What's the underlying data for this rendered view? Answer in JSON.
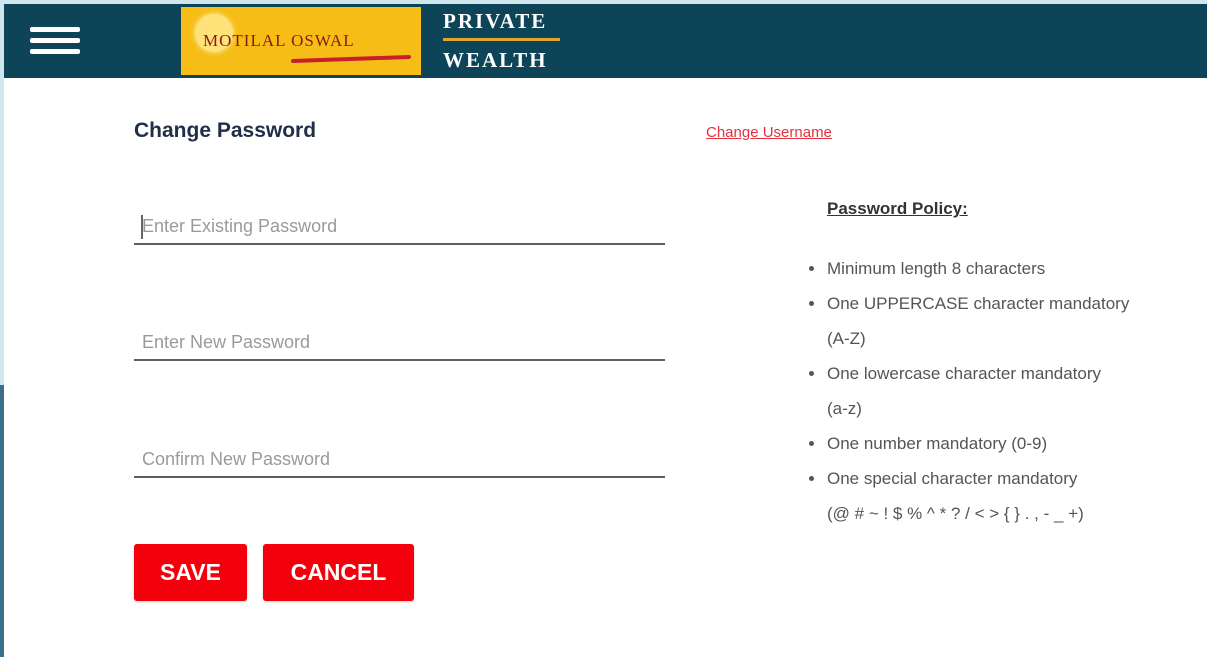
{
  "header": {
    "brand_logo_text": "MOTILAL OSWAL",
    "brand_line1": "PRIVATE",
    "brand_line2": "WEALTH",
    "colors": {
      "bar": "#0e4458",
      "logo_bg": "#f6bd16",
      "accent_red": "#f3000c"
    }
  },
  "form": {
    "title": "Change Password",
    "change_username_link": "Change Username",
    "existing_placeholder": "Enter Existing Password",
    "new_placeholder": "Enter New Password",
    "confirm_placeholder": "Confirm New Password",
    "save_label": "SAVE",
    "cancel_label": "CANCEL"
  },
  "policy": {
    "title": "Password Policy:",
    "items": [
      {
        "text": "Minimum length 8 characters",
        "sub": ""
      },
      {
        "text": "One UPPERCASE character mandatory",
        "sub": "(A-Z)"
      },
      {
        "text": "One lowercase character mandatory",
        "sub": "(a-z)"
      },
      {
        "text": "One number mandatory (0-9)",
        "sub": ""
      },
      {
        "text": "One special character mandatory",
        "sub": "(@ # ~ ! $ % ^ * ? / < > { } . , - _ +)"
      }
    ]
  },
  "icons": [
    "hamburger-menu-icon",
    "motilal-oswal-logo"
  ]
}
